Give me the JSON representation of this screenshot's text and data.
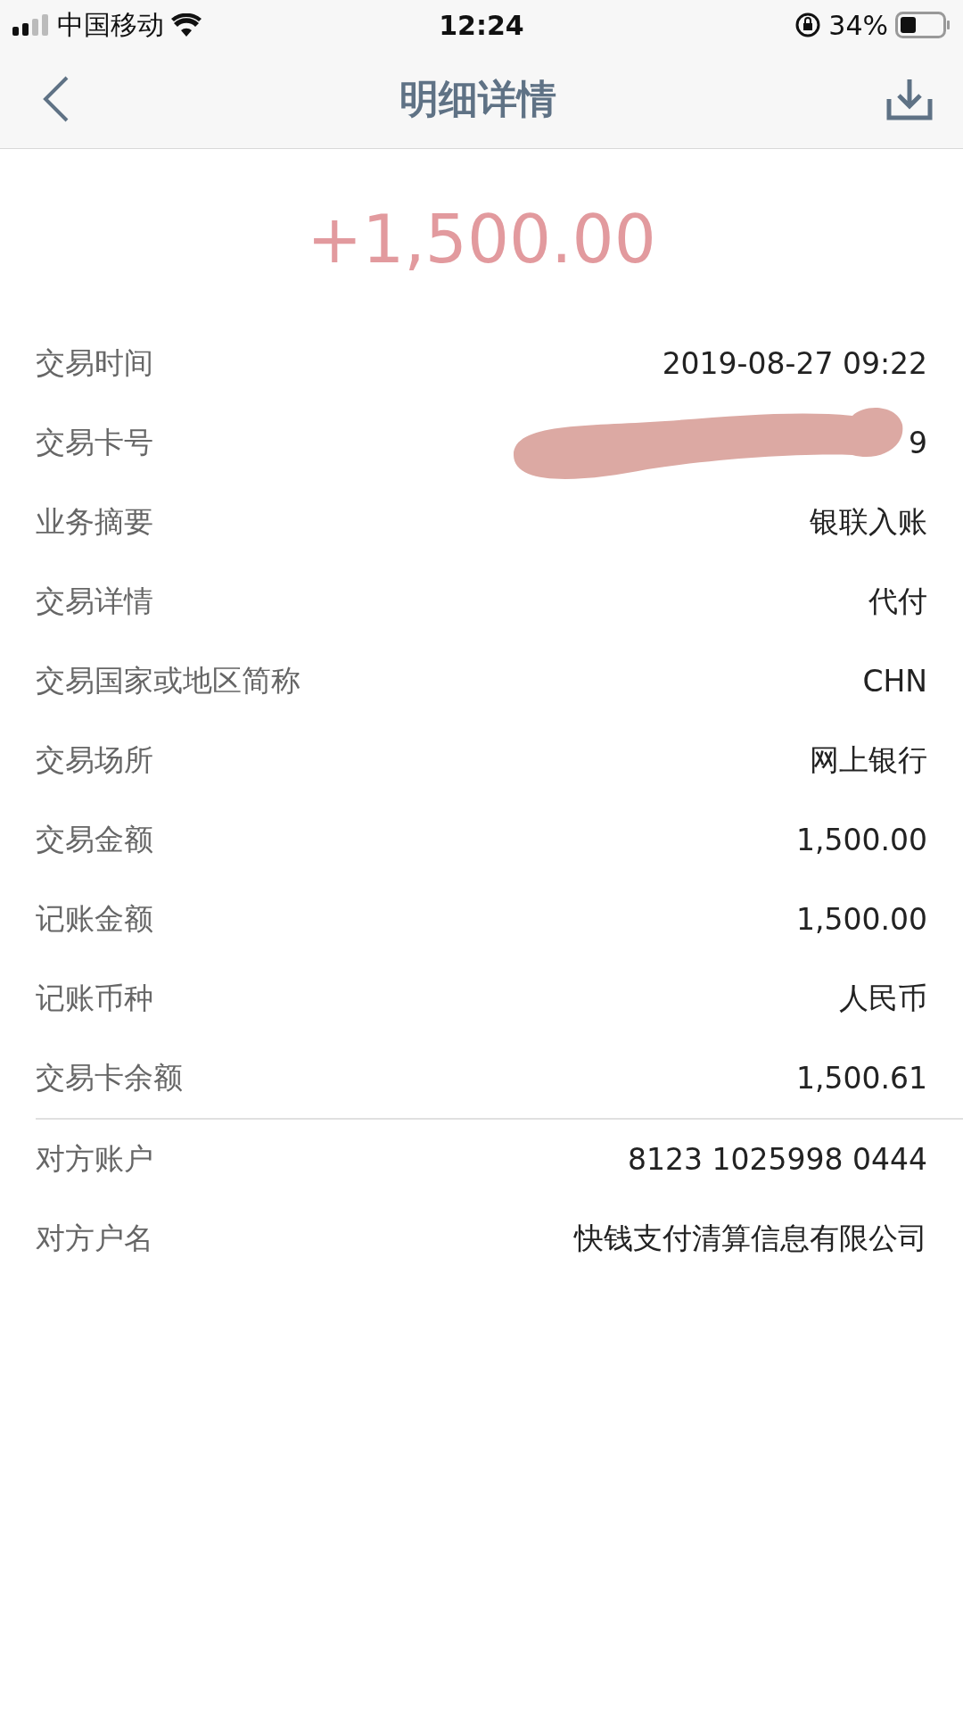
{
  "status_bar": {
    "carrier": "中国移动",
    "time": "12:24",
    "battery": "34%"
  },
  "nav": {
    "title": "明细详情"
  },
  "amount": "+1,500.00",
  "details": [
    {
      "label": "交易时间",
      "value": "2019-08-27 09:22"
    },
    {
      "label": "交易卡号",
      "value": "9",
      "redacted": true
    },
    {
      "label": "业务摘要",
      "value": "银联入账"
    },
    {
      "label": "交易详情",
      "value": "代付"
    },
    {
      "label": "交易国家或地区简称",
      "value": "CHN"
    },
    {
      "label": "交易场所",
      "value": "网上银行"
    },
    {
      "label": "交易金额",
      "value": "1,500.00"
    },
    {
      "label": "记账金额",
      "value": "1,500.00"
    },
    {
      "label": "记账币种",
      "value": "人民币"
    },
    {
      "label": "交易卡余额",
      "value": "1,500.61"
    }
  ],
  "counterparty": [
    {
      "label": "对方账户",
      "value": "8123 1025998 0444"
    },
    {
      "label": "对方户名",
      "value": "快钱支付清算信息有限公司"
    }
  ]
}
